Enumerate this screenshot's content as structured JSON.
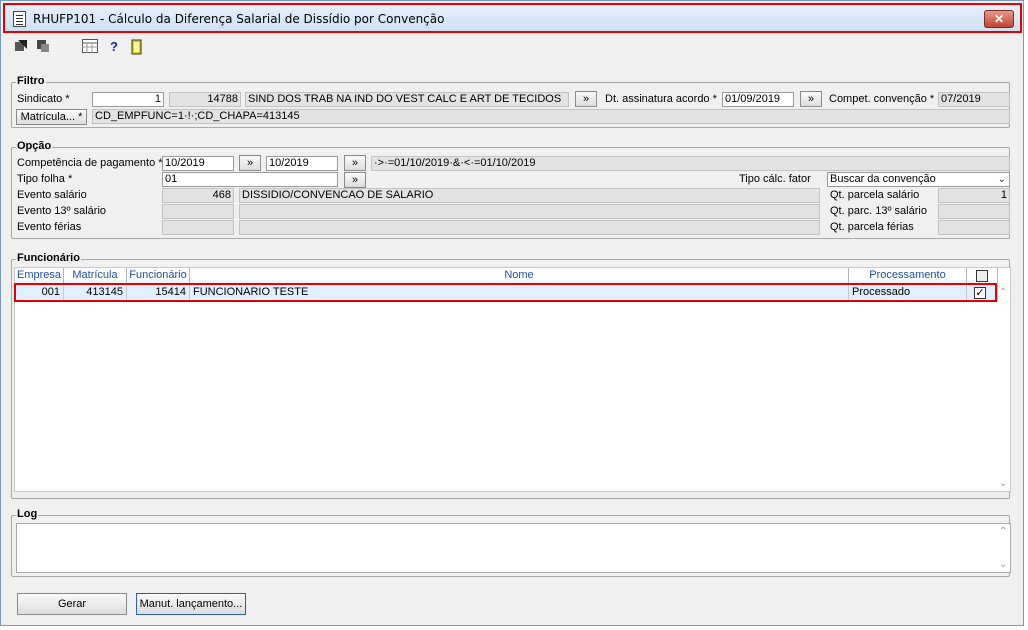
{
  "window": {
    "title": "RHUFP101 - Cálculo da Diferença Salarial de Dissídio por Convenção",
    "close_label": "✕"
  },
  "toolbar": {
    "icons": [
      "execute-icon",
      "stop-icon",
      "calculator-icon",
      "help-icon",
      "exit-icon"
    ]
  },
  "filtro": {
    "title": "Filtro",
    "sindicato_label": "Sindicato *",
    "sindicato_code": "1",
    "sindicato_id": "14788",
    "sindicato_name": "SIND DOS TRAB NA IND DO VEST CALC E ART DE TECIDOS",
    "lookup_btn": "»",
    "dt_assinatura_label": "Dt. assinatura acordo *",
    "dt_assinatura_value": "01/09/2019",
    "compet_convencao_label": "Compet. convenção *",
    "compet_convencao_value": "07/2019",
    "matricula_btn": "Matrícula... *",
    "matricula_filter": "CD_EMPFUNC=1·!·;CD_CHAPA=413145"
  },
  "opcao": {
    "title": "Opção",
    "competencia_label": "Competência de pagamento *",
    "competencia_from": "10/2019",
    "competencia_to": "10/2019",
    "competencia_expr": "·>·=01/10/2019·&·<·=01/10/2019",
    "tipo_folha_label": "Tipo folha *",
    "tipo_folha_value": "01",
    "tipo_calc_label": "Tipo cálc. fator",
    "tipo_calc_value": "Buscar da convenção",
    "evento_salario_label": "Evento salário",
    "evento_salario_code": "468",
    "evento_salario_desc": "DISSIDIO/CONVENCAO DE SALARIO",
    "evento_13_label": "Evento 13º salário",
    "evento_ferias_label": "Evento férias",
    "qt_parcela_salario_label": "Qt. parcela salário",
    "qt_parcela_salario_value": "1",
    "qt_parc_13_label": "Qt. parc. 13º salário",
    "qt_parcela_ferias_label": "Qt. parcela férias"
  },
  "funcionario": {
    "title": "Funcionário",
    "columns": [
      "Empresa",
      "Matrícula",
      "Funcionário",
      "Nome",
      "Processamento"
    ],
    "rows": [
      {
        "empresa": "001",
        "matricula": "413145",
        "funcionario": "15414",
        "nome": "FUNCIONARIO TESTE",
        "processamento": "Processado",
        "checked": "✓"
      }
    ]
  },
  "log": {
    "title": "Log"
  },
  "actions": {
    "gerar": "Gerar",
    "manut": "Manut. lançamento..."
  }
}
